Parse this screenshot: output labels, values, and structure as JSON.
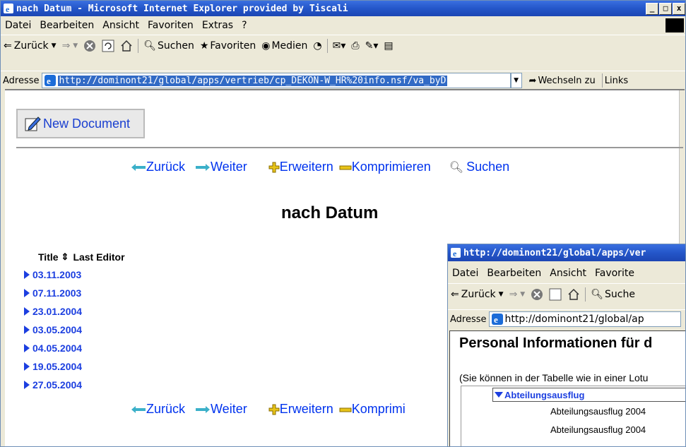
{
  "main_window": {
    "title": "nach Datum - Microsoft Internet Explorer provided by Tiscali",
    "controls": [
      "_",
      "□",
      "x"
    ],
    "menu": [
      "Datei",
      "Bearbeiten",
      "Ansicht",
      "Favoriten",
      "Extras",
      "?"
    ],
    "toolbar": {
      "back": "Zurück",
      "search": "Suchen",
      "favorites": "Favoriten",
      "media": "Medien"
    },
    "address": {
      "label": "Adresse",
      "url": "http://dominont21/global/apps/vertrieb/cp_DEKON-W_HR%20info.nsf/va_byD",
      "go": "Wechseln zu",
      "links": "Links"
    }
  },
  "page": {
    "new_document": "New Document",
    "nav": {
      "back": "Zurück",
      "next": "Weiter",
      "expand": "Erweitern",
      "collapse": "Komprimieren",
      "search": "Suchen"
    },
    "nav_bottom_collapse": "Komprimi",
    "heading": "nach Datum",
    "columns": {
      "title": "Title",
      "sort_icon": "⇕",
      "editor": "Last Editor"
    },
    "rows": [
      "03.11.2003",
      "07.11.2003",
      "23.01.2004",
      "03.05.2004",
      "04.05.2004",
      "19.05.2004",
      "27.05.2004"
    ]
  },
  "second_window": {
    "title": "http://dominont21/global/apps/ver",
    "menu": [
      "Datei",
      "Bearbeiten",
      "Ansicht",
      "Favorite"
    ],
    "toolbar": {
      "back": "Zurück",
      "search": "Suche"
    },
    "address": {
      "label": "Adresse",
      "url": "http://dominont21/global/ap"
    },
    "heading": "Personal Informationen für d",
    "note": "(Sie können in der Tabelle wie in einer Lotu",
    "category": "Abteilungsausflug",
    "entries": [
      "Abteilungsausflug 2004",
      "Abteilungsausflug 2004"
    ]
  },
  "colors": {
    "xp_title": "#2456c9",
    "link": "#0033ee",
    "selection": "#316ac5"
  }
}
